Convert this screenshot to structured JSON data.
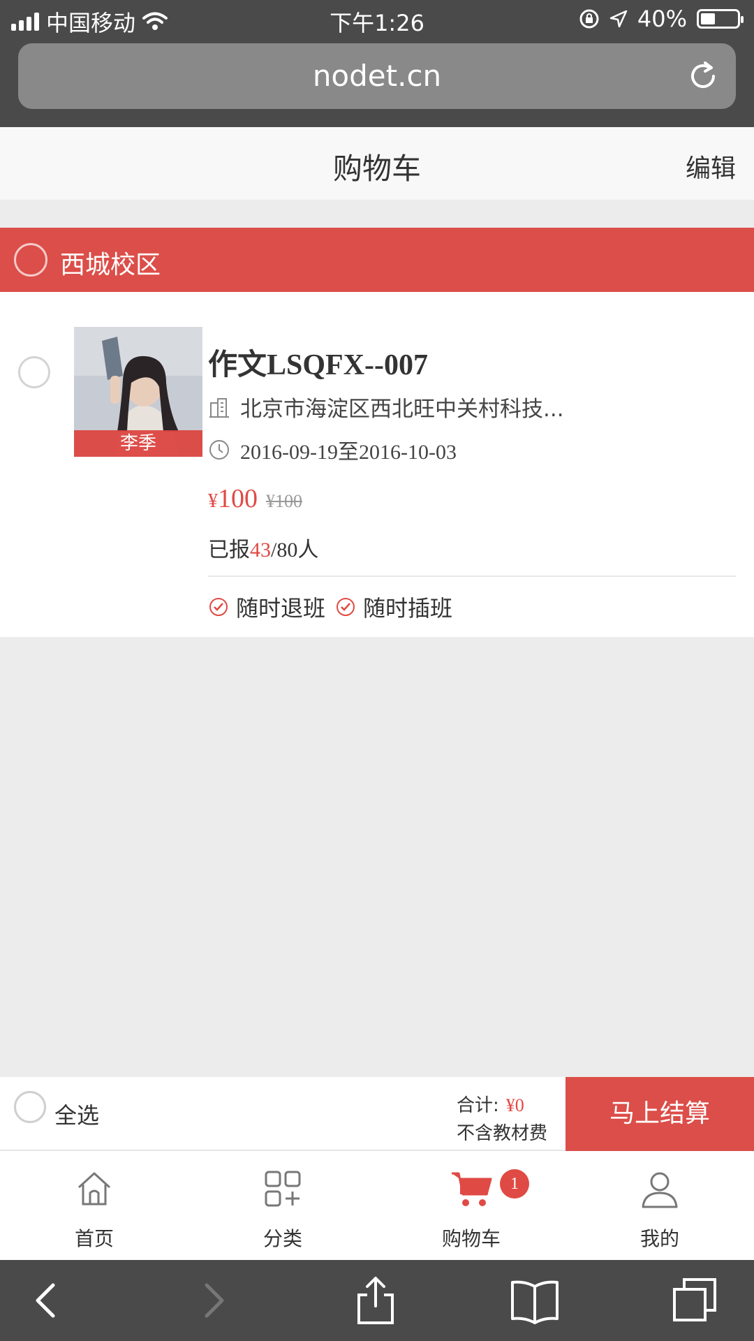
{
  "status_bar": {
    "carrier": "中国移动",
    "time": "下午1:26",
    "battery": "40%",
    "battery_level": 0.4
  },
  "browser": {
    "url": "nodet.cn"
  },
  "header": {
    "title": "购物车",
    "edit_label": "编辑"
  },
  "campus": {
    "name": "西城校区"
  },
  "course": {
    "teacher": "李季",
    "title": "作文LSQFX--007",
    "address": "北京市海淀区西北旺中关村科技...",
    "dates": "2016-09-19至2016-10-03",
    "currency": "¥",
    "price": "100",
    "original_price": "¥100",
    "enroll_prefix": "已报",
    "enrolled": "43",
    "enroll_suffix": "/80人",
    "tags": [
      "随时退班",
      "随时插班"
    ]
  },
  "summary": {
    "select_all": "全选",
    "total_label": "合计:",
    "total_value": "¥0",
    "note": "不含教材费",
    "checkout": "马上结算"
  },
  "tabs": [
    {
      "label": "首页",
      "icon": "home-icon"
    },
    {
      "label": "分类",
      "icon": "category-icon"
    },
    {
      "label": "购物车",
      "icon": "cart-icon",
      "badge": "1"
    },
    {
      "label": "我的",
      "icon": "user-icon"
    }
  ],
  "colors": {
    "accent": "#dc4e49",
    "price": "#e04a44"
  }
}
